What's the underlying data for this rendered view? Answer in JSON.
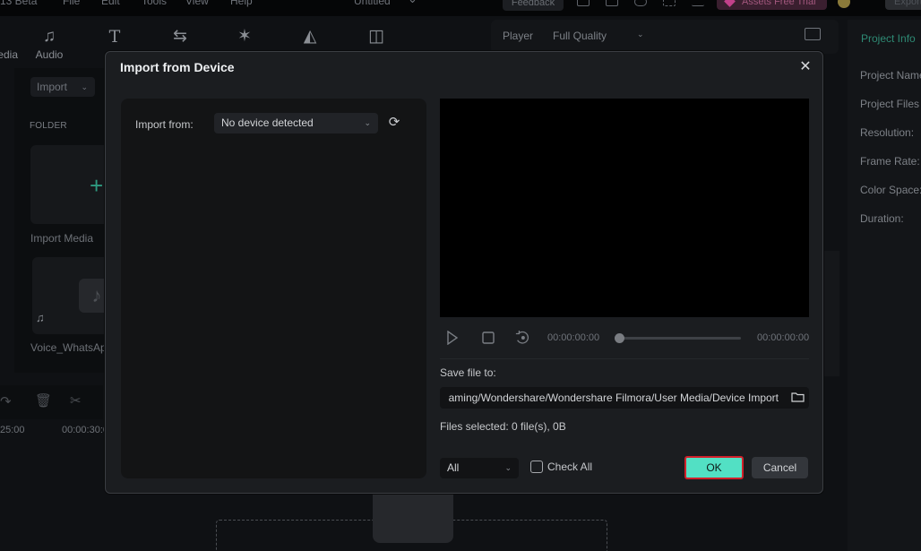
{
  "menubar": {
    "app_title_fragment": "13 Beta",
    "menus": [
      "File",
      "Edit",
      "Tools",
      "View",
      "Help"
    ],
    "project_title": "Untitled",
    "feedback_label": "Feedback",
    "assets_label": "Assets Free Trial",
    "export_label": "Export"
  },
  "toolbar": {
    "items": [
      {
        "label": "Media",
        "icon": "media-icon"
      },
      {
        "label": "Audio",
        "icon": "music-note-icon"
      },
      {
        "label": "Titles",
        "icon": "text-icon"
      },
      {
        "label": "Transitions",
        "icon": "transition-icon"
      },
      {
        "label": "Effects",
        "icon": "effects-icon"
      },
      {
        "label": "Stickers",
        "icon": "stickers-icon"
      },
      {
        "label": "Templates",
        "icon": "templates-icon"
      }
    ]
  },
  "media_panel": {
    "import_label": "Import",
    "folder_label": "FOLDER",
    "tiles": [
      {
        "label": "Import Media"
      },
      {
        "label": "Voice_WhatsAp"
      }
    ]
  },
  "timeline": {
    "ruler": [
      "25:00",
      "00:00:30:0"
    ]
  },
  "player": {
    "label": "Player",
    "quality": "Full Quality"
  },
  "project_info": {
    "tab_label": "Project Info",
    "rows": [
      "Project Name",
      "Project Files L",
      "Resolution:",
      "Frame Rate:",
      "Color Space:",
      "Duration:"
    ]
  },
  "dialog": {
    "title": "Import from Device",
    "import_from_label": "Import from:",
    "device_value": "No device detected",
    "time_start": "00:00:00:00",
    "time_end": "00:00:00:00",
    "progress": 0,
    "save_label": "Save file to:",
    "save_path": "aming/Wondershare/Wondershare Filmora/User Media/Device Import",
    "files_selected": "Files selected:  0 file(s), 0B",
    "filter_value": "All",
    "check_all_label": "Check All",
    "check_all_checked": false,
    "ok_label": "OK",
    "cancel_label": "Cancel",
    "ok_highlight_color": "#d0202a",
    "ok_color": "#52e0c4"
  }
}
